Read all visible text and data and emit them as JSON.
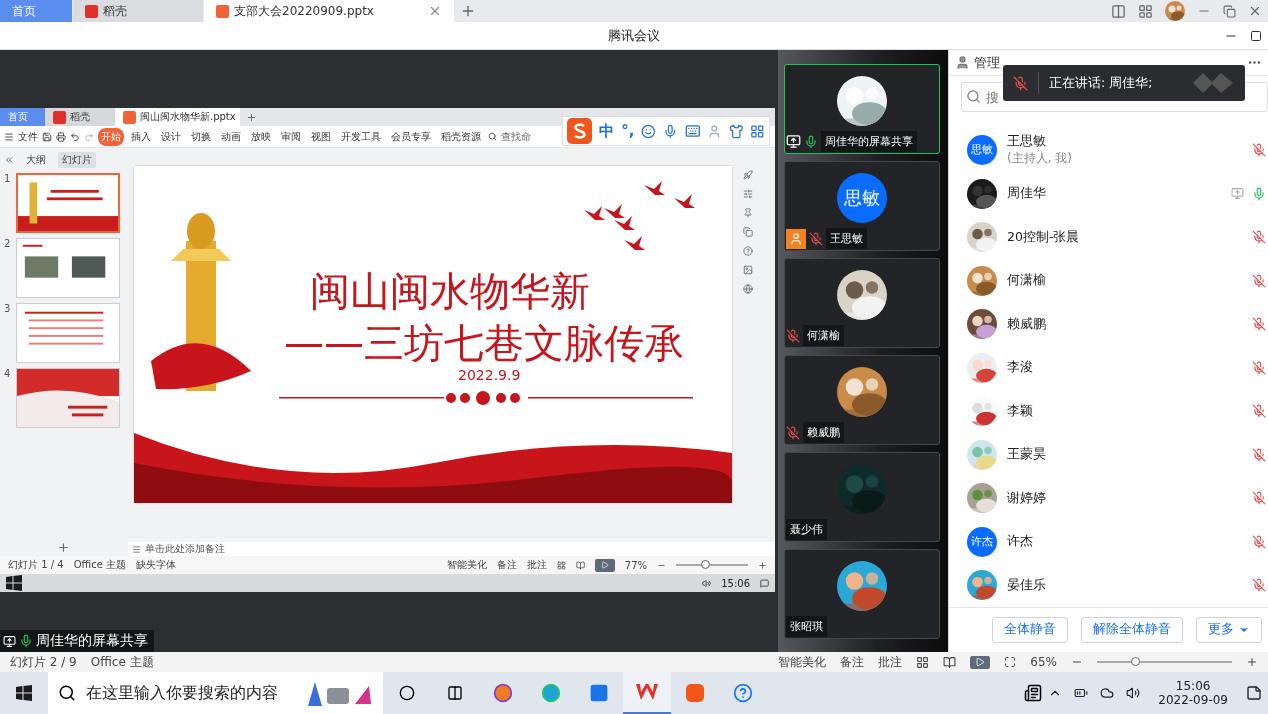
{
  "browser_tabs": [
    {
      "label": "首页",
      "selected": false,
      "kind": "home"
    },
    {
      "label": "稻壳",
      "selected": false,
      "kind": "docer"
    },
    {
      "label": "支部大会20220909.pptx",
      "selected": true,
      "kind": "pptx"
    }
  ],
  "meeting_title": "腾讯会议",
  "share": {
    "wps_tabs": [
      {
        "label": "首页",
        "selected": false,
        "kind": "home"
      },
      {
        "label": "稻壳",
        "selected": false,
        "kind": "docer"
      },
      {
        "label": "闽山闽水物华新.pptx",
        "selected": true,
        "kind": "pptx"
      }
    ],
    "file_menu": "文件",
    "ribbon_tabs": [
      {
        "label": "开始",
        "selected": true
      },
      {
        "label": "插入",
        "selected": false
      },
      {
        "label": "设计",
        "selected": false
      },
      {
        "label": "切换",
        "selected": false
      },
      {
        "label": "动画",
        "selected": false
      },
      {
        "label": "放映",
        "selected": false
      },
      {
        "label": "审阅",
        "selected": false
      },
      {
        "label": "视图",
        "selected": false
      },
      {
        "label": "开发工具",
        "selected": false
      },
      {
        "label": "会员专享",
        "selected": false
      },
      {
        "label": "稻壳资源",
        "selected": false
      }
    ],
    "command_search": "查找命",
    "panel_tabs": [
      {
        "label": "大纲",
        "selected": false
      },
      {
        "label": "幻灯片",
        "selected": true
      }
    ],
    "thumbnails": [
      {
        "number": "1",
        "selected": true,
        "kind": "title"
      },
      {
        "number": "2",
        "selected": false,
        "kind": "photos"
      },
      {
        "number": "3",
        "selected": false,
        "kind": "text"
      },
      {
        "number": "4",
        "selected": false,
        "kind": "flag"
      }
    ],
    "slide": {
      "title": "闽山闽水物华新",
      "subtitle": "——三坊七巷文脉传承",
      "date": "2022.9.9"
    },
    "notes_placeholder": "单击此处添加备注",
    "status": {
      "slide_count": "幻灯片 1 / 4",
      "theme": "Office 主题",
      "missing_font": "缺失字体",
      "beautify": "智能美化",
      "notes": "备注",
      "comments": "批注",
      "zoom": "77%",
      "zoom_slider": {
        "level": 0.4
      }
    },
    "clock": "15:06",
    "sharer": "周佳华的屏幕共享"
  },
  "ime": {
    "labels": [
      "中",
      "°,"
    ]
  },
  "videos": [
    {
      "name": "周佳华的屏幕共享",
      "selected": true,
      "kind": "screen_share",
      "mic": {
        "muted": false
      }
    },
    {
      "name": "王思敏",
      "selected": false,
      "kind": "host",
      "mic": {
        "muted": true
      },
      "avatar": {
        "kind": "text",
        "text": "思敏"
      }
    },
    {
      "name": "何潇榆",
      "selected": false,
      "kind": "guest",
      "mic": {
        "muted": true
      }
    },
    {
      "name": "赖威鹏",
      "selected": false,
      "kind": "guest",
      "mic": {
        "muted": true
      }
    },
    {
      "name": "聂少伟",
      "selected": false,
      "kind": "guest"
    },
    {
      "name": "张昭琪",
      "selected": false,
      "kind": "guest"
    }
  ],
  "members": {
    "header": "管理",
    "search_placeholder": "搜",
    "toast": "正在讲话: 周佳华;",
    "list": [
      {
        "name": "王思敏",
        "note": "(主持人, 我)",
        "muted": true,
        "sharing": false,
        "avatar": {
          "kind": "text",
          "text": "思敏"
        }
      },
      {
        "name": "周佳华",
        "muted": false,
        "sharing": true
      },
      {
        "name": "20控制-张晨",
        "muted": true,
        "sharing": false
      },
      {
        "name": "何潇榆",
        "muted": true,
        "sharing": false
      },
      {
        "name": "赖威鹏",
        "muted": true,
        "sharing": false
      },
      {
        "name": "李浚",
        "muted": true,
        "sharing": false
      },
      {
        "name": "李颖",
        "muted": true,
        "sharing": false
      },
      {
        "name": "王蒙昊",
        "muted": true,
        "sharing": false
      },
      {
        "name": "谢婷婷",
        "muted": true,
        "sharing": false
      },
      {
        "name": "许杰",
        "muted": true,
        "sharing": false,
        "avatar": {
          "kind": "text",
          "text": "许杰"
        }
      },
      {
        "name": "晏佳乐",
        "muted": true,
        "sharing": false
      }
    ],
    "buttons": [
      {
        "label": "全体静音",
        "dropdown": false
      },
      {
        "label": "解除全体静音",
        "dropdown": false
      },
      {
        "label": "更多",
        "dropdown": true
      }
    ]
  },
  "doc_status": {
    "slide_count": "幻灯片 2 / 9",
    "theme": "Office 主题",
    "beautify": "智能美化",
    "notes": "备注",
    "comments": "批注",
    "zoom": "65%",
    "zoom_slider": {
      "level": 0.28
    }
  },
  "taskbar": {
    "search_placeholder": "在这里输入你要搜索的内容",
    "time": "15:06",
    "date": "2022-09-09"
  }
}
